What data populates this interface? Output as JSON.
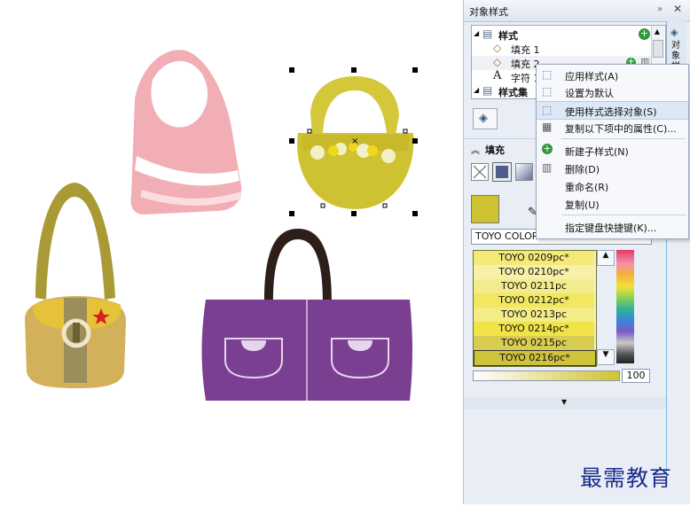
{
  "panel": {
    "title": "对象样式",
    "side_tab": "对象样",
    "tree": [
      {
        "label": "样式",
        "bold": true
      },
      {
        "label": "填充 1"
      },
      {
        "label": "填充 2"
      },
      {
        "label": "字符 1"
      },
      {
        "label": "样式集",
        "bold": true
      }
    ],
    "fill_section": "填充",
    "color_model": "TOYO COLOR FINDER",
    "swatches": [
      {
        "label": "TOYO 0209pc*",
        "color": "#f5ea78"
      },
      {
        "label": "TOYO 0210pc*",
        "color": "#f7f0a8"
      },
      {
        "label": "TOYO 0211pc",
        "color": "#f3ec8c"
      },
      {
        "label": "TOYO 0212pc*",
        "color": "#f1e760"
      },
      {
        "label": "TOYO 0213pc",
        "color": "#f4ec86"
      },
      {
        "label": "TOYO 0214pc*",
        "color": "#f0e448"
      },
      {
        "label": "TOYO 0215pc",
        "color": "#d8cd52"
      },
      {
        "label": "TOYO 0216pc*",
        "color": "#cfc33c"
      }
    ],
    "tint_value": "100"
  },
  "menu": {
    "items": [
      {
        "label": "应用样式(A)",
        "highlight": false
      },
      {
        "label": "设置为默认",
        "highlight": false
      },
      {
        "label": "使用样式选择对象(S)",
        "highlight": true
      },
      {
        "label": "复制以下项中的属性(C)...",
        "highlight": false
      },
      {
        "label": "新建子样式(N)",
        "highlight": false
      },
      {
        "label": "删除(D)",
        "highlight": false
      },
      {
        "label": "重命名(R)",
        "highlight": false
      },
      {
        "label": "复制(U)",
        "highlight": false
      },
      {
        "label": "指定键盘快捷键(K)...",
        "highlight": false
      }
    ]
  },
  "watermark": "最需教育",
  "colors": {
    "accent": "#2f7f2f",
    "selection": "#000000"
  }
}
